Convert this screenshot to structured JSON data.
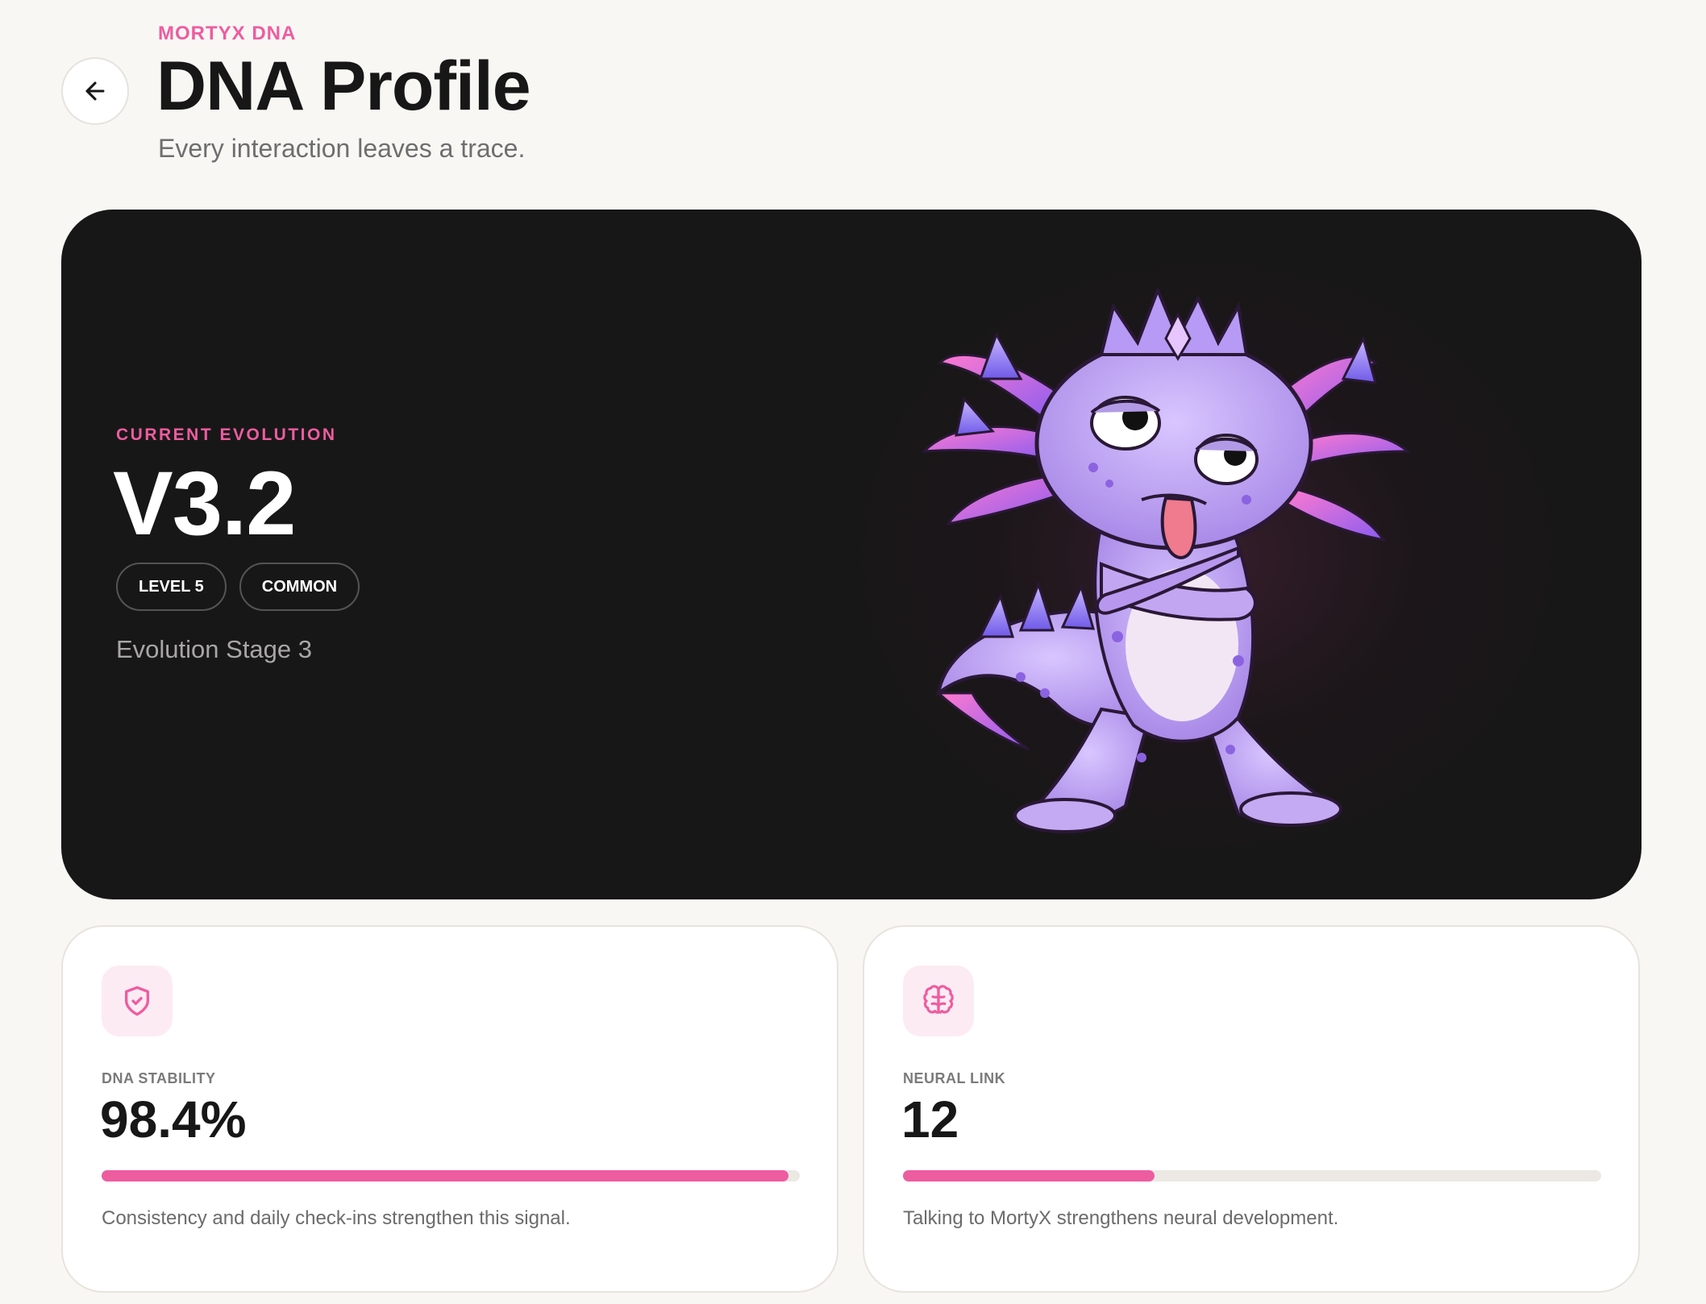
{
  "header": {
    "eyebrow": "MORTYX DNA",
    "title": "DNA Profile",
    "subtitle": "Every interaction leaves a trace.",
    "back_icon": "arrow-left-icon"
  },
  "hero": {
    "label": "CURRENT EVOLUTION",
    "version": "V3.2",
    "badges": [
      "LEVEL 5",
      "COMMON"
    ],
    "stage": "Evolution Stage 3",
    "image": "purple-axolotl-mascot-with-crown"
  },
  "stats": [
    {
      "icon": "shield-check-icon",
      "label": "DNA STABILITY",
      "value": "98.4%",
      "progress": 0.984,
      "description": "Consistency and daily check-ins strengthen this signal."
    },
    {
      "icon": "brain-icon",
      "label": "NEURAL LINK",
      "value": "12",
      "progress": 0.36,
      "description": "Talking to MortyX strengthens neural development."
    }
  ],
  "colors": {
    "accent": "#ee5ca0",
    "hero_bg": "#181718",
    "page_bg": "#f8f7f4",
    "icon_bg": "#fdebf3"
  }
}
